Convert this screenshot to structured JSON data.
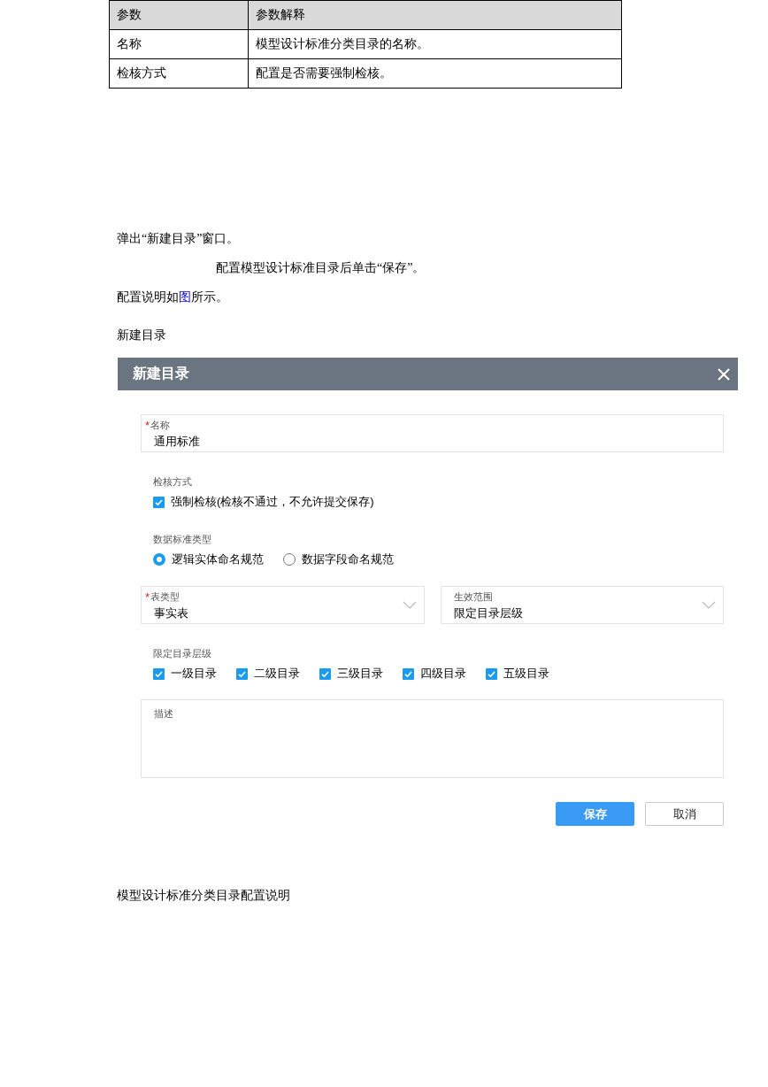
{
  "param_table": {
    "columns": [
      "参数",
      "参数解释"
    ],
    "rows": [
      [
        "名称",
        "模型设计标准分类目录的名称。"
      ],
      [
        "检核方式",
        "配置是否需要强制检核。"
      ]
    ]
  },
  "steps": [
    {
      "kind": "plain",
      "text": "弹出“新建目录”窗口。"
    },
    {
      "kind": "indented",
      "text": "配置模型设计标准目录后单击“保存”。"
    },
    {
      "kind": "link",
      "before": "配置说明如",
      "link": "图",
      "after": "所示。"
    }
  ],
  "figure_caption": "新建目录",
  "dialog": {
    "title": "新建目录",
    "name_field": {
      "required_mark": "*",
      "label": "名称",
      "value": "通用标准"
    },
    "check_method": {
      "label": "检核方式",
      "options": [
        {
          "label": "强制检核(检核不通过，不允许提交保存)",
          "checked": true
        }
      ]
    },
    "data_standard_type": {
      "label": "数据标准类型",
      "options": [
        {
          "label": "逻辑实体命名规范",
          "selected": true
        },
        {
          "label": "数据字段命名规范",
          "selected": false
        }
      ]
    },
    "selects": [
      {
        "required_mark": "*",
        "label": "表类型",
        "value": "事实表"
      },
      {
        "label": "生效范围",
        "value": "限定目录层级"
      }
    ],
    "levels": {
      "label": "限定目录层级",
      "options": [
        {
          "label": "一级目录",
          "checked": true
        },
        {
          "label": "二级目录",
          "checked": true
        },
        {
          "label": "三级目录",
          "checked": true
        },
        {
          "label": "四级目录",
          "checked": true
        },
        {
          "label": "五级目录",
          "checked": true
        }
      ]
    },
    "description": {
      "label": "描述"
    },
    "buttons": [
      {
        "label": "保存",
        "kind": "primary"
      },
      {
        "label": "取消",
        "kind": "default"
      }
    ]
  },
  "table_caption": "模型设计标准分类目录配置说明"
}
